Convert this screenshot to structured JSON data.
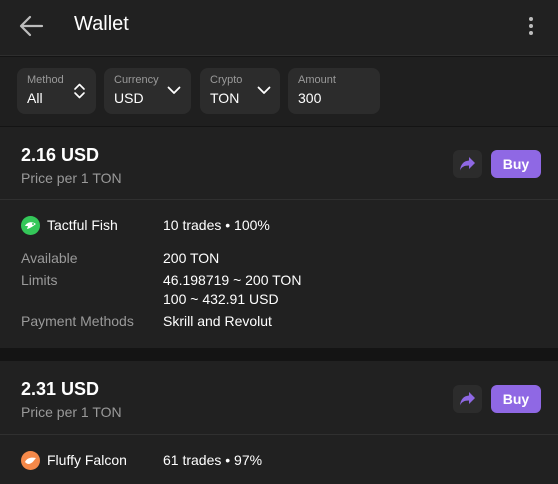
{
  "header": {
    "title": "Wallet",
    "back_icon": "arrow-left-icon",
    "menu_icon": "more-vertical-icon"
  },
  "filters": {
    "method": {
      "label": "Method",
      "value": "All",
      "icon": "chevron-up-down-icon"
    },
    "currency": {
      "label": "Currency",
      "value": "USD",
      "icon": "chevron-down-icon"
    },
    "crypto": {
      "label": "Crypto",
      "value": "TON",
      "icon": "chevron-down-icon"
    },
    "amount": {
      "label": "Amount",
      "value": "300"
    }
  },
  "offers": [
    {
      "price": "2.16 USD",
      "price_sub": "Price per 1 TON",
      "buy_label": "Buy",
      "share_icon": "share-arrow-icon",
      "trader": {
        "name": "Tactful Fish",
        "stats": "10 trades • 100%",
        "avatar_color": "#34c759",
        "avatar_icon": "fish-icon"
      },
      "available_label": "Available",
      "available": "200 TON",
      "limits_label": "Limits",
      "limits_crypto": "46.198719 ~ 200 TON",
      "limits_fiat": "100 ~ 432.91 USD",
      "payment_label": "Payment Methods",
      "payment_methods": "Skrill and Revolut"
    },
    {
      "price": "2.31 USD",
      "price_sub": "Price per 1 TON",
      "buy_label": "Buy",
      "share_icon": "share-arrow-icon",
      "trader": {
        "name": "Fluffy Falcon",
        "stats": "61 trades • 97%",
        "avatar_color": "#f5894a",
        "avatar_icon": "falcon-icon"
      }
    }
  ],
  "colors": {
    "background": "#141414",
    "card": "#212121",
    "field": "#2c2c2c",
    "accent": "#8f68e4",
    "muted_text": "#9a9a9a"
  }
}
